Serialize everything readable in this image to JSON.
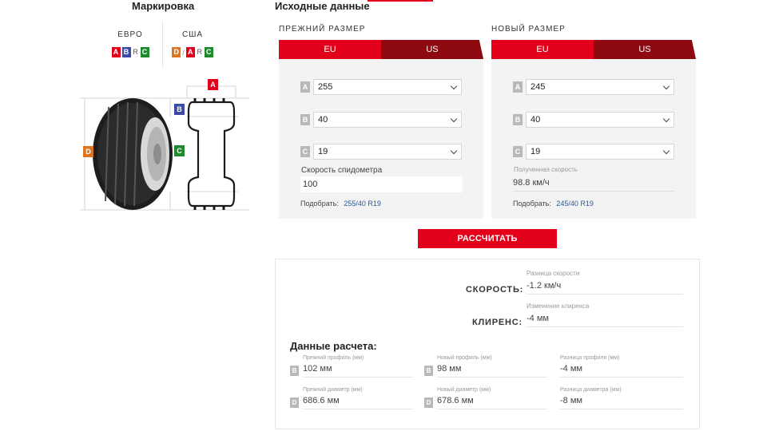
{
  "headings": {
    "marking": "Маркировка",
    "source": "Исходные данные"
  },
  "standards": {
    "euro": {
      "title": "ЕВРО",
      "letters": [
        "A",
        "B",
        "R",
        "C"
      ]
    },
    "usa": {
      "title": "США",
      "letters": [
        "D",
        "A",
        "R",
        "C"
      ],
      "separator": "/"
    }
  },
  "tire_labels": {
    "a": "A",
    "b": "B",
    "c": "C",
    "d": "D"
  },
  "old_size": {
    "label": "ПРЕЖНИЙ РАЗМЕР",
    "tabs": [
      "EU",
      "US"
    ],
    "tags": [
      "A",
      "B",
      "C"
    ],
    "width": "255",
    "profile": "40",
    "rim": "19",
    "speedo_label": "Скорость спидометра",
    "speedo_value": "100",
    "pick_label": "Подобрать:",
    "pick_link": "255/40 R19"
  },
  "new_size": {
    "label": "НОВЫЙ РАЗМЕР",
    "tabs": [
      "EU",
      "US"
    ],
    "tags": [
      "A",
      "B",
      "C"
    ],
    "width": "245",
    "profile": "40",
    "rim": "19",
    "received_label": "Полученная скорость",
    "received_value": "98.8 км/ч",
    "pick_label": "Подобрать:",
    "pick_link": "245/40 R19"
  },
  "calc_button": "РАССЧИТАТЬ",
  "result": {
    "speed": {
      "label": "СКОРОСТЬ:",
      "sub": "Разница скорости",
      "value": "-1.2 км/ч"
    },
    "clearance": {
      "label": "КЛИРЕНС:",
      "sub": "Изменение клиренса",
      "value": "-4 мм"
    },
    "calc_title": "Данные расчета:",
    "old_profile": {
      "tag": "B",
      "label": "Прежний профиль (мм)",
      "value": "102 мм"
    },
    "new_profile": {
      "tag": "B",
      "label": "Новый профиль (мм)",
      "value": "98 мм"
    },
    "profile_diff": {
      "label": "Разница профиля (мм)",
      "value": "-4 мм"
    },
    "old_diameter": {
      "tag": "D",
      "label": "Прежний диаметр (мм)",
      "value": "686.6 мм"
    },
    "new_diameter": {
      "tag": "D",
      "label": "Новый диаметр (мм)",
      "value": "678.6 мм"
    },
    "diameter_diff": {
      "label": "Разница диаметра (мм)",
      "value": "-8 мм"
    }
  },
  "colors": {
    "accent": "#e3001b",
    "tab_dark": "#8e0a10",
    "letter_b": "#3b4aa8",
    "letter_c": "#1e8a2e",
    "letter_d": "#e0741c"
  }
}
